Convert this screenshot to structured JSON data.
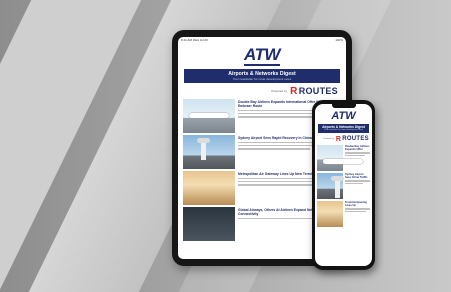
{
  "brand": {
    "logo": "ATW",
    "newsletter_title": "Airports & Networks Digest",
    "newsletter_subtitle": "Your newsletter for route development news",
    "powered_by": "Powered by",
    "partner": "ROUTES",
    "partner_mark": "R",
    "navy": "#1f2d6d",
    "red": "#e1251b"
  },
  "tablet": {
    "status_left": "9:41 AM   Wed Jul 20",
    "status_right": "100%",
    "articles": [
      {
        "headline": "Double Bay Airlines Expands International Offer With First Embraer Route",
        "image": "aircraft-photo"
      },
      {
        "headline": "Sydney Airport Sees Rapid Recovery In China Traffic",
        "image": "control-tower-photo"
      },
      {
        "headline": "Metropolitan Air Gateway Lines Up New Terminal Opening",
        "image": "terminal-interior-photo"
      },
      {
        "headline": "Global Airways, Others At Airlines Expand Network Connectivity",
        "image": "dark-photo"
      }
    ]
  },
  "phone": {
    "status_left": "9:41",
    "status_right": "LTE",
    "articles": [
      {
        "headline": "Double Bay Airlines Expands Offer",
        "image": "aircraft-photo"
      },
      {
        "headline": "Sydney Airport Sees China Traffic",
        "image": "control-tower-photo"
      },
      {
        "headline": "Terminal Opening Lines Up",
        "image": "terminal-interior-photo"
      }
    ]
  }
}
